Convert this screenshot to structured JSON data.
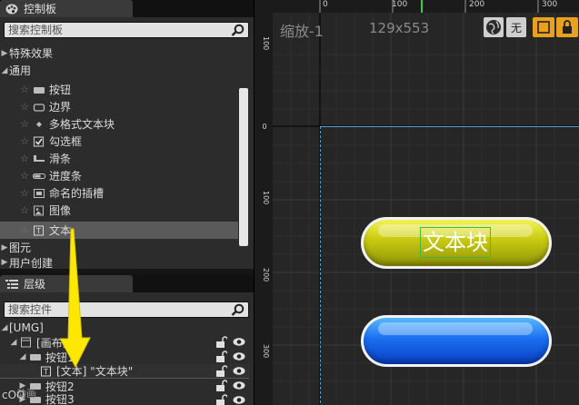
{
  "palette": {
    "title": "控制板",
    "search_placeholder": "搜索控制板",
    "categories": [
      {
        "label": "特殊效果",
        "expanded": false
      },
      {
        "label": "通用",
        "expanded": true
      },
      {
        "label": "图元",
        "expanded": false
      },
      {
        "label": "用户创建",
        "expanded": false
      }
    ],
    "items": [
      {
        "label": "按钮",
        "icon": "button-icon"
      },
      {
        "label": "边界",
        "icon": "border-icon"
      },
      {
        "label": "多格式文本块",
        "icon": "rich-text-icon"
      },
      {
        "label": "勾选框",
        "icon": "checkbox-icon"
      },
      {
        "label": "滑条",
        "icon": "slider-icon"
      },
      {
        "label": "进度条",
        "icon": "progress-bar-icon"
      },
      {
        "label": "命名的插槽",
        "icon": "named-slot-icon"
      },
      {
        "label": "图像",
        "icon": "image-icon"
      },
      {
        "label": "文本",
        "icon": "text-icon",
        "selected": true
      }
    ]
  },
  "hierarchy": {
    "title": "层级",
    "search_placeholder": "搜索控件",
    "root": "[UMG]",
    "rows": [
      {
        "label": "[画布面",
        "indent": 1,
        "expanded": true
      },
      {
        "label": "按钮1",
        "indent": 2,
        "expanded": true
      },
      {
        "label": "[文本] \"文本块\"",
        "indent": 3,
        "selected": true
      },
      {
        "label": "按钮2",
        "indent": 2,
        "expanded": false
      },
      {
        "label": "按钮3",
        "indent": 2,
        "expanded": false
      }
    ],
    "overlap_label": "动画"
  },
  "designer": {
    "zoom_label": "缩放-1",
    "resolution": "129x553",
    "ruler_top": [
      "0",
      "100",
      "200",
      "300"
    ],
    "ruler_left": [
      "100",
      "0",
      "100",
      "200",
      "300"
    ],
    "none_label": "无",
    "button1_text": "文本块",
    "accent": "#4aa6d8",
    "yellow": "#cbcd12",
    "blue": "#1a6ff0"
  },
  "watermark": "cOO"
}
